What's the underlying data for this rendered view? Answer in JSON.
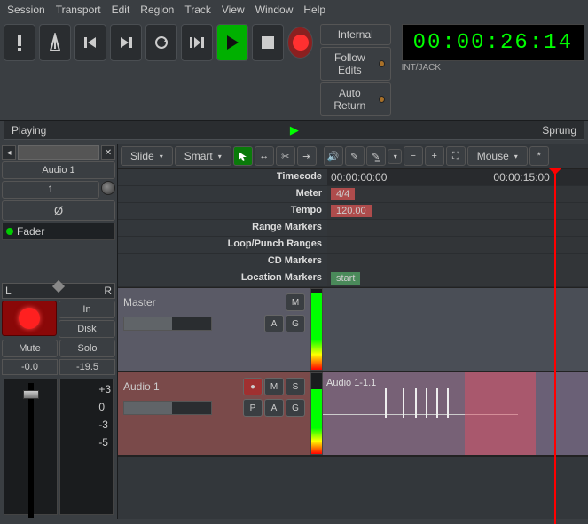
{
  "menu": [
    "Session",
    "Transport",
    "Edit",
    "Region",
    "Track",
    "View",
    "Window",
    "Help"
  ],
  "transport": {
    "status": "Playing",
    "sprung": "Sprung",
    "internal": "Internal",
    "follow_edits": "Follow Edits",
    "auto_return": "Auto Return"
  },
  "timecode": {
    "big": "00:00:26:14",
    "label": "INT/JACK"
  },
  "mixer": {
    "track_name": "Audio 1",
    "input_num": "1",
    "phase": "Ø",
    "fader": "Fader",
    "pan_l": "L",
    "pan_r": "R",
    "in": "In",
    "disk": "Disk",
    "mute": "Mute",
    "solo": "Solo",
    "gain": "-0.0",
    "peak": "-19.5",
    "scale": [
      "+3",
      "0",
      "-3",
      "-5"
    ]
  },
  "toolbar": {
    "mode1": "Slide",
    "mode2": "Smart",
    "snap": "Mouse",
    "star": "*"
  },
  "rulers": {
    "labels": [
      "Timecode",
      "Meter",
      "Tempo",
      "Range Markers",
      "Loop/Punch Ranges",
      "CD Markers",
      "Location Markers"
    ],
    "tc": [
      "00:00:00:00",
      "00:00:15:00"
    ],
    "meter": "4/4",
    "tempo": "120.00",
    "loc": "start"
  },
  "tracks": {
    "master": {
      "name": "Master",
      "m": "M",
      "a": "A",
      "g": "G"
    },
    "audio": {
      "name": "Audio 1",
      "m": "M",
      "s": "S",
      "p": "P",
      "a": "A",
      "g": "G",
      "region": "Audio 1-1.1"
    }
  }
}
